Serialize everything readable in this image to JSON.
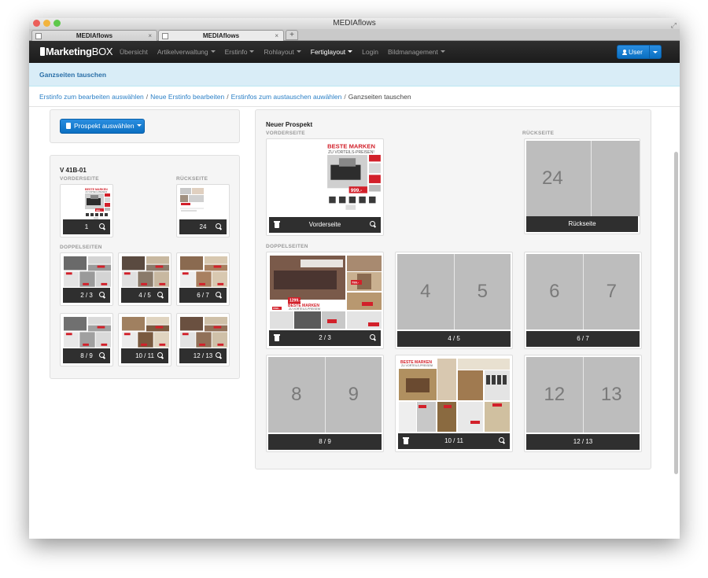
{
  "window": {
    "title": "MEDIAflows"
  },
  "tabs": [
    {
      "label": "MEDIAflows"
    },
    {
      "label": "MEDIAflows"
    }
  ],
  "new_tab_symbol": "+",
  "navbar": {
    "brand_bold": "Marketing",
    "brand_rest": "BOX",
    "items": [
      {
        "label": "Übersicht",
        "dropdown": false
      },
      {
        "label": "Artikelverwaltung",
        "dropdown": true
      },
      {
        "label": "Erstinfo",
        "dropdown": true
      },
      {
        "label": "Rohlayout",
        "dropdown": true
      },
      {
        "label": "Fertiglayout",
        "dropdown": true,
        "active": true
      },
      {
        "label": "Login",
        "dropdown": false
      },
      {
        "label": "Bildmanagement",
        "dropdown": true
      }
    ],
    "user_label": "User"
  },
  "info_title": "Ganzseiten tauschen",
  "breadcrumb": [
    {
      "label": "Erstinfo zum bearbeiten auswählen",
      "link": true
    },
    {
      "label": "Neue Erstinfo bearbeiten",
      "link": true
    },
    {
      "label": "Erstinfos zum austauschen auwählen",
      "link": true
    },
    {
      "label": "Ganzseiten tauschen",
      "link": false
    }
  ],
  "breadcrumb_separator": "/",
  "left": {
    "select_button": "Prospekt auswählen",
    "title": "V 41B-01",
    "front_label": "VORDERSEITE",
    "back_label": "RÜCKSEITE",
    "front_page": "1",
    "back_page": "24",
    "spreads_label": "DOPPELSEITEN",
    "spreads": [
      "2 / 3",
      "4 / 5",
      "6 / 7",
      "8 / 9",
      "10 / 11",
      "12 / 13"
    ]
  },
  "right": {
    "title": "Neuer Prospekt",
    "front_label": "VORDERSEITE",
    "back_label": "RÜCKSEITE",
    "front_caption": "Vorderseite",
    "back_caption": "Rückseite",
    "back_placeholder": "24",
    "spreads_label": "DOPPELSEITEN",
    "spreads": [
      {
        "caption": "2 / 3",
        "left": "",
        "right": "",
        "filled": true
      },
      {
        "caption": "4 / 5",
        "left": "4",
        "right": "5",
        "filled": false
      },
      {
        "caption": "6 / 7",
        "left": "6",
        "right": "7",
        "filled": false
      },
      {
        "caption": "8 / 9",
        "left": "8",
        "right": "9",
        "filled": false
      },
      {
        "caption": "10 / 11",
        "left": "",
        "right": "",
        "filled": true
      },
      {
        "caption": "12 / 13",
        "left": "12",
        "right": "13",
        "filled": false
      }
    ]
  },
  "flyer_text": {
    "headline": "BESTE MARKEN",
    "subline": "ZU VORTEILS-PREISEN!",
    "prices": [
      "999.-",
      "1299.-",
      "799.-",
      "1599.-"
    ]
  },
  "colors": {
    "accent": "#0a6fc2",
    "flyer_red": "#d2202a",
    "placeholder": "#bdbdbd",
    "caption_bg": "#2f2f2f",
    "info_bg": "#d9edf7"
  }
}
